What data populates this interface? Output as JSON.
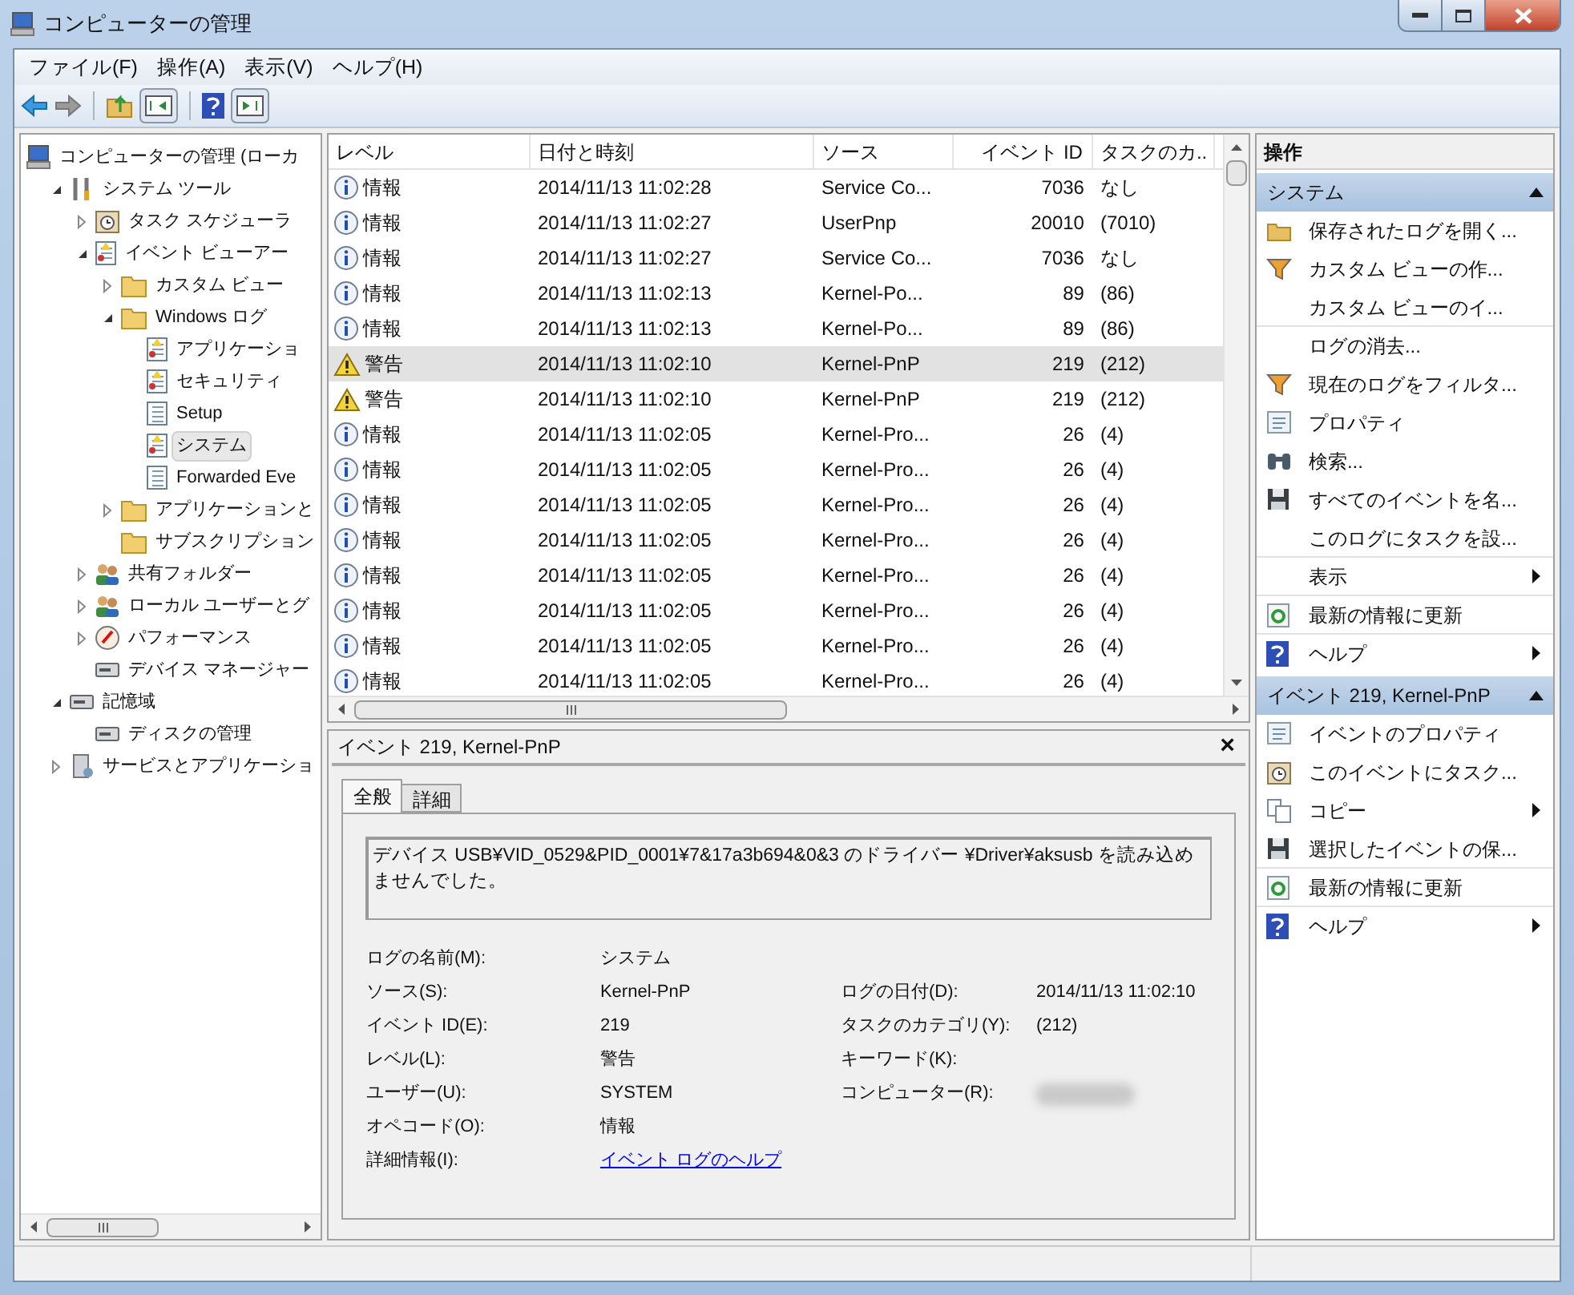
{
  "window": {
    "title": "コンピューターの管理"
  },
  "menu": [
    "ファイル(F)",
    "操作(A)",
    "表示(V)",
    "ヘルプ(H)"
  ],
  "tree": [
    {
      "label": "コンピューターの管理 (ローカ",
      "selected": false,
      "children": [
        {
          "label": "システム ツール",
          "selected": false,
          "expanded": true,
          "children": [
            {
              "label": "タスク スケジューラ",
              "selected": false,
              "expanded": false
            },
            {
              "label": "イベント ビューアー",
              "selected": false,
              "expanded": true,
              "children": [
                {
                  "label": "カスタム ビュー",
                  "selected": false,
                  "expanded": false
                },
                {
                  "label": "Windows ログ",
                  "selected": false,
                  "expanded": true,
                  "children": [
                    {
                      "label": "アプリケーショ",
                      "selected": false
                    },
                    {
                      "label": "セキュリティ",
                      "selected": false
                    },
                    {
                      "label": "Setup",
                      "selected": false
                    },
                    {
                      "label": "システム",
                      "selected": true
                    },
                    {
                      "label": "Forwarded Eve",
                      "selected": false
                    }
                  ]
                },
                {
                  "label": "アプリケーションと",
                  "selected": false,
                  "expanded": false
                },
                {
                  "label": "サブスクリプション",
                  "selected": false
                }
              ]
            },
            {
              "label": "共有フォルダー",
              "selected": false,
              "expanded": false
            },
            {
              "label": "ローカル ユーザーとグ",
              "selected": false,
              "expanded": false
            },
            {
              "label": "パフォーマンス",
              "selected": false,
              "expanded": false
            },
            {
              "label": "デバイス マネージャー",
              "selected": false
            }
          ]
        },
        {
          "label": "記憶域",
          "selected": false,
          "expanded": true,
          "children": [
            {
              "label": "ディスクの管理",
              "selected": false
            }
          ]
        },
        {
          "label": "サービスとアプリケーショ",
          "selected": false,
          "expanded": false
        }
      ]
    }
  ],
  "table": {
    "columns": [
      "レベル",
      "日付と時刻",
      "ソース",
      "イベント ID",
      "タスクのカ.."
    ],
    "rows": [
      {
        "kind": "info",
        "level": "情報",
        "date": "2014/11/13 11:02:28",
        "source": "Service Co...",
        "event_id": "7036",
        "task": "なし",
        "selected": false
      },
      {
        "kind": "info",
        "level": "情報",
        "date": "2014/11/13 11:02:27",
        "source": "UserPnp",
        "event_id": "20010",
        "task": "(7010)",
        "selected": false
      },
      {
        "kind": "info",
        "level": "情報",
        "date": "2014/11/13 11:02:27",
        "source": "Service Co...",
        "event_id": "7036",
        "task": "なし",
        "selected": false
      },
      {
        "kind": "info",
        "level": "情報",
        "date": "2014/11/13 11:02:13",
        "source": "Kernel-Po...",
        "event_id": "89",
        "task": "(86)",
        "selected": false
      },
      {
        "kind": "info",
        "level": "情報",
        "date": "2014/11/13 11:02:13",
        "source": "Kernel-Po...",
        "event_id": "89",
        "task": "(86)",
        "selected": false
      },
      {
        "kind": "warning",
        "level": "警告",
        "date": "2014/11/13 11:02:10",
        "source": "Kernel-PnP",
        "event_id": "219",
        "task": "(212)",
        "selected": true
      },
      {
        "kind": "warning",
        "level": "警告",
        "date": "2014/11/13 11:02:10",
        "source": "Kernel-PnP",
        "event_id": "219",
        "task": "(212)",
        "selected": false
      },
      {
        "kind": "info",
        "level": "情報",
        "date": "2014/11/13 11:02:05",
        "source": "Kernel-Pro...",
        "event_id": "26",
        "task": "(4)",
        "selected": false
      },
      {
        "kind": "info",
        "level": "情報",
        "date": "2014/11/13 11:02:05",
        "source": "Kernel-Pro...",
        "event_id": "26",
        "task": "(4)",
        "selected": false
      },
      {
        "kind": "info",
        "level": "情報",
        "date": "2014/11/13 11:02:05",
        "source": "Kernel-Pro...",
        "event_id": "26",
        "task": "(4)",
        "selected": false
      },
      {
        "kind": "info",
        "level": "情報",
        "date": "2014/11/13 11:02:05",
        "source": "Kernel-Pro...",
        "event_id": "26",
        "task": "(4)",
        "selected": false
      },
      {
        "kind": "info",
        "level": "情報",
        "date": "2014/11/13 11:02:05",
        "source": "Kernel-Pro...",
        "event_id": "26",
        "task": "(4)",
        "selected": false
      },
      {
        "kind": "info",
        "level": "情報",
        "date": "2014/11/13 11:02:05",
        "source": "Kernel-Pro...",
        "event_id": "26",
        "task": "(4)",
        "selected": false
      },
      {
        "kind": "info",
        "level": "情報",
        "date": "2014/11/13 11:02:05",
        "source": "Kernel-Pro...",
        "event_id": "26",
        "task": "(4)",
        "selected": false
      },
      {
        "kind": "info",
        "level": "情報",
        "date": "2014/11/13 11:02:05",
        "source": "Kernel-Pro...",
        "event_id": "26",
        "task": "(4)",
        "selected": false
      }
    ]
  },
  "detail": {
    "title": "イベント 219, Kernel-PnP",
    "close": "×",
    "tabs": [
      {
        "label": "全般",
        "selected": true
      },
      {
        "label": "詳細",
        "selected": false
      }
    ],
    "message": "デバイス USB¥VID_0529&PID_0001¥7&17a3b694&0&3 のドライバー ¥Driver¥aksusb を読み込めませんでした。",
    "fields_left": [
      {
        "label": "ログの名前(M):",
        "value": "システム"
      },
      {
        "label": "ソース(S):",
        "value": "Kernel-PnP"
      },
      {
        "label": "イベント ID(E):",
        "value": "219"
      },
      {
        "label": "レベル(L):",
        "value": "警告"
      },
      {
        "label": "ユーザー(U):",
        "value": "SYSTEM"
      },
      {
        "label": "オペコード(O):",
        "value": "情報"
      },
      {
        "label": "詳細情報(I):",
        "value": "イベント ログのヘルプ",
        "kind": "link"
      }
    ],
    "fields_right": [
      {
        "label": "ログの日付(D):",
        "value": "2014/11/13 11:02:10"
      },
      {
        "label": "タスクのカテゴリ(Y):",
        "value": "(212)"
      },
      {
        "label": "キーワード(K):"
      },
      {
        "label": "コンピューター(R):",
        "kind": "blurred"
      }
    ]
  },
  "actions": {
    "title": "操作",
    "sections": [
      {
        "title": "システム",
        "expanded": true,
        "items": [
          {
            "label": "保存されたログを開く...",
            "submenu": false,
            "separator_after": false
          },
          {
            "label": "カスタム ビューの作...",
            "submenu": false,
            "separator_after": false
          },
          {
            "label": "カスタム ビューのイ...",
            "submenu": false,
            "separator_after": true
          },
          {
            "label": "ログの消去...",
            "submenu": false,
            "separator_after": false
          },
          {
            "label": "現在のログをフィルタ...",
            "submenu": false,
            "separator_after": false
          },
          {
            "label": "プロパティ",
            "submenu": false,
            "separator_after": false
          },
          {
            "label": "検索...",
            "submenu": false,
            "separator_after": false
          },
          {
            "label": "すべてのイベントを名...",
            "submenu": false,
            "separator_after": false
          },
          {
            "label": "このログにタスクを設...",
            "submenu": false,
            "separator_after": true
          },
          {
            "label": "表示",
            "submenu": true,
            "separator_after": true
          },
          {
            "label": "最新の情報に更新",
            "submenu": false,
            "separator_after": true
          },
          {
            "label": "ヘルプ",
            "submenu": true,
            "separator_after": false
          }
        ]
      },
      {
        "title": "イベント 219, Kernel-PnP",
        "expanded": true,
        "items": [
          {
            "label": "イベントのプロパティ",
            "submenu": false,
            "separator_after": false
          },
          {
            "label": "このイベントにタスク...",
            "submenu": false,
            "separator_after": false
          },
          {
            "label": "コピー",
            "submenu": true,
            "separator_after": false
          },
          {
            "label": "選択したイベントの保...",
            "submenu": false,
            "separator_after": true
          },
          {
            "label": "最新の情報に更新",
            "submenu": false,
            "separator_after": true
          },
          {
            "label": "ヘルプ",
            "submenu": true,
            "separator_after": false
          }
        ]
      }
    ]
  }
}
